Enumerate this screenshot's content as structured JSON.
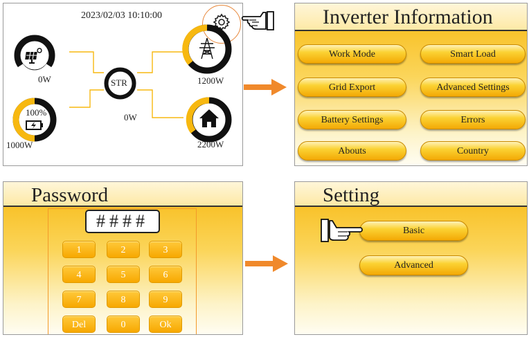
{
  "home": {
    "datetime": "2023/02/03 10:10:00",
    "center_label": "STR",
    "center_power": "0W",
    "solar_power": "0W",
    "grid_power": "1200W",
    "battery_percent": "100%",
    "battery_power": "1000W",
    "load_power": "2200W"
  },
  "inverter_info": {
    "title": "Inverter Information",
    "buttons": [
      "Work Mode",
      "Smart Load",
      "Grid Export",
      "Advanced Settings",
      "Battery Settings",
      "Errors",
      "Abouts",
      "Country"
    ]
  },
  "password": {
    "title": "Password",
    "display": "####",
    "keys": [
      "1",
      "2",
      "3",
      "4",
      "5",
      "6",
      "7",
      "8",
      "9",
      "Del",
      "0",
      "Ok"
    ]
  },
  "setting": {
    "title": "Setting",
    "buttons": [
      "Basic",
      "Advanced"
    ]
  },
  "colors": {
    "accent": "#f7b810",
    "arrow": "#f0892b",
    "gauge_ring": "#f7b810",
    "highlight_circle": "#e8873a"
  },
  "icons": [
    "gear-icon",
    "pointing-hand-icon",
    "solar-panel-icon",
    "grid-tower-icon",
    "battery-icon",
    "house-icon",
    "arrow-right-icon"
  ]
}
